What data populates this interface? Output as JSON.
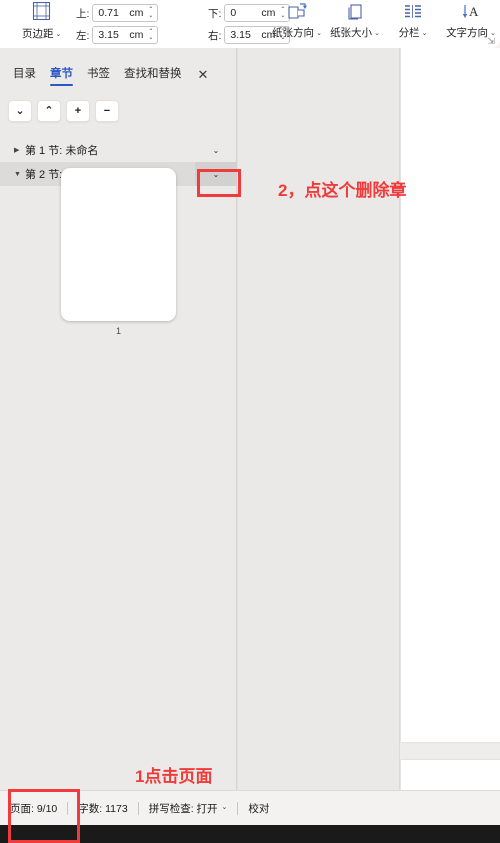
{
  "ribbon": {
    "margins": {
      "icon": "page-margins-icon",
      "label": "页边距",
      "caret": "⌄"
    },
    "fields": [
      {
        "label": "上:",
        "value": "0.71",
        "unit": "cm",
        "name": "margin-top-field"
      },
      {
        "label": "下:",
        "value": "0",
        "unit": "cm",
        "name": "margin-bottom-field"
      },
      {
        "label": "左:",
        "value": "3.15",
        "unit": "cm",
        "name": "margin-left-field"
      },
      {
        "label": "右:",
        "value": "3.15",
        "unit": "cm",
        "name": "margin-right-field"
      }
    ],
    "tools": [
      {
        "label": "纸张方向",
        "icon": "page-orientation-icon",
        "caret": "⌄"
      },
      {
        "label": "纸张大小",
        "icon": "page-size-icon",
        "caret": "⌄"
      },
      {
        "label": "分栏",
        "icon": "columns-icon",
        "caret": "⌄"
      },
      {
        "label": "文字方向",
        "icon": "text-direction-icon",
        "caret": "⌄"
      }
    ],
    "expander": "⇲"
  },
  "navpane": {
    "tabs": [
      {
        "label": "目录",
        "active": false
      },
      {
        "label": "章节",
        "active": true
      },
      {
        "label": "书签",
        "active": false
      },
      {
        "label": "查找和替换",
        "active": false
      }
    ],
    "close_label": "✕",
    "buttons": [
      {
        "glyph": "⌄",
        "name": "nav-next-button"
      },
      {
        "glyph": "⌃",
        "name": "nav-prev-button"
      },
      {
        "glyph": "+",
        "name": "nav-add-section-button"
      },
      {
        "glyph": "−",
        "name": "nav-remove-section-button"
      }
    ],
    "sections": [
      {
        "triangle": "▶",
        "label": "第 1 节: 未命名",
        "chevron": "⌄",
        "selected": false
      },
      {
        "triangle": "▼",
        "label": "第 2 节: 未命名",
        "chevron": "⌄",
        "selected": true
      }
    ],
    "thumbnail": {
      "page_number": "1"
    }
  },
  "statusbar": {
    "pages": "页面: 9/10",
    "words": "字数: 1173",
    "spellcheck": "拼写检查: 打开",
    "spellcheck_caret": "⌄",
    "proofread": "校对"
  },
  "annotations": [
    {
      "id": "step2",
      "text": "2，点这个删除章"
    },
    {
      "id": "step1",
      "text": "1点击页面"
    }
  ],
  "colors": {
    "accent_blue": "#2b57c4",
    "annotation_red": "#ef3b3b",
    "pane_bg": "#eceae8",
    "selected_row": "#dddbd9"
  }
}
